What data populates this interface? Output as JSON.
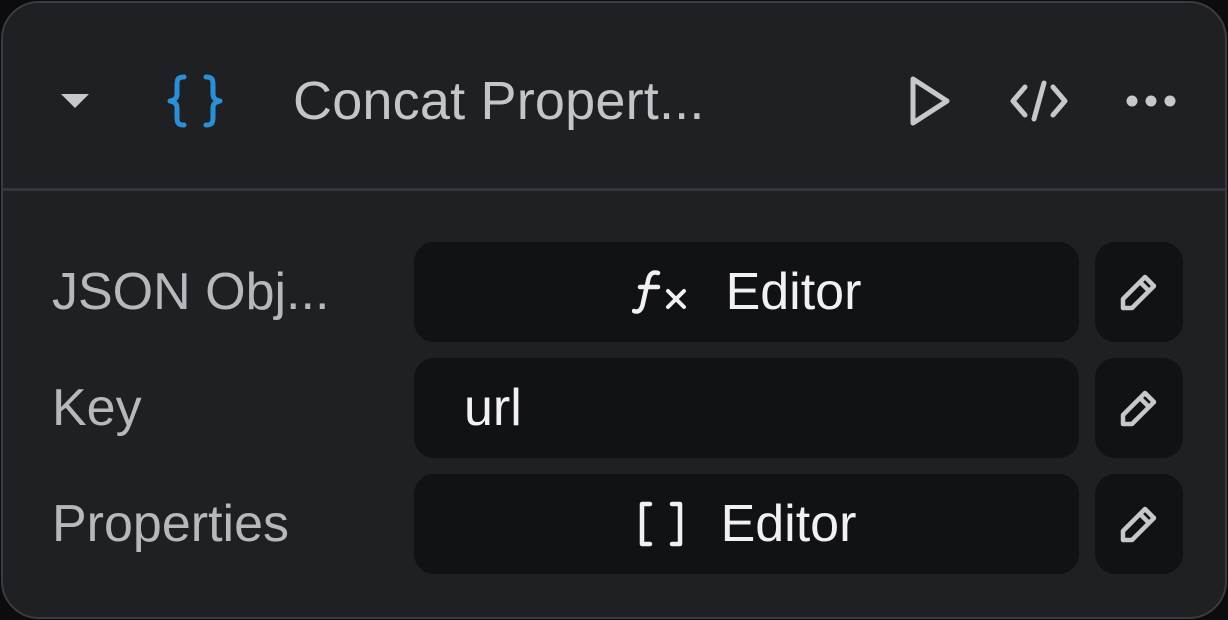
{
  "node": {
    "title": "Concat Propert...",
    "icons": {
      "collapse": "caret-down-icon",
      "type": "json-braces-icon",
      "run": "play-icon",
      "code": "code-icon",
      "more": "more-dots-icon"
    },
    "colors": {
      "accent_blue": "#2a8fd6",
      "background": "#1f2024",
      "field_background": "#111214",
      "label_text": "#b7b8bc",
      "value_text": "#f1f1f3"
    }
  },
  "fields": [
    {
      "label": "JSON Obj...",
      "value_type_icon": "function-icon",
      "value": "Editor"
    },
    {
      "label": "Key",
      "value": "url"
    },
    {
      "label": "Properties",
      "value_type_icon": "array-brackets-icon",
      "value": "Editor"
    }
  ]
}
